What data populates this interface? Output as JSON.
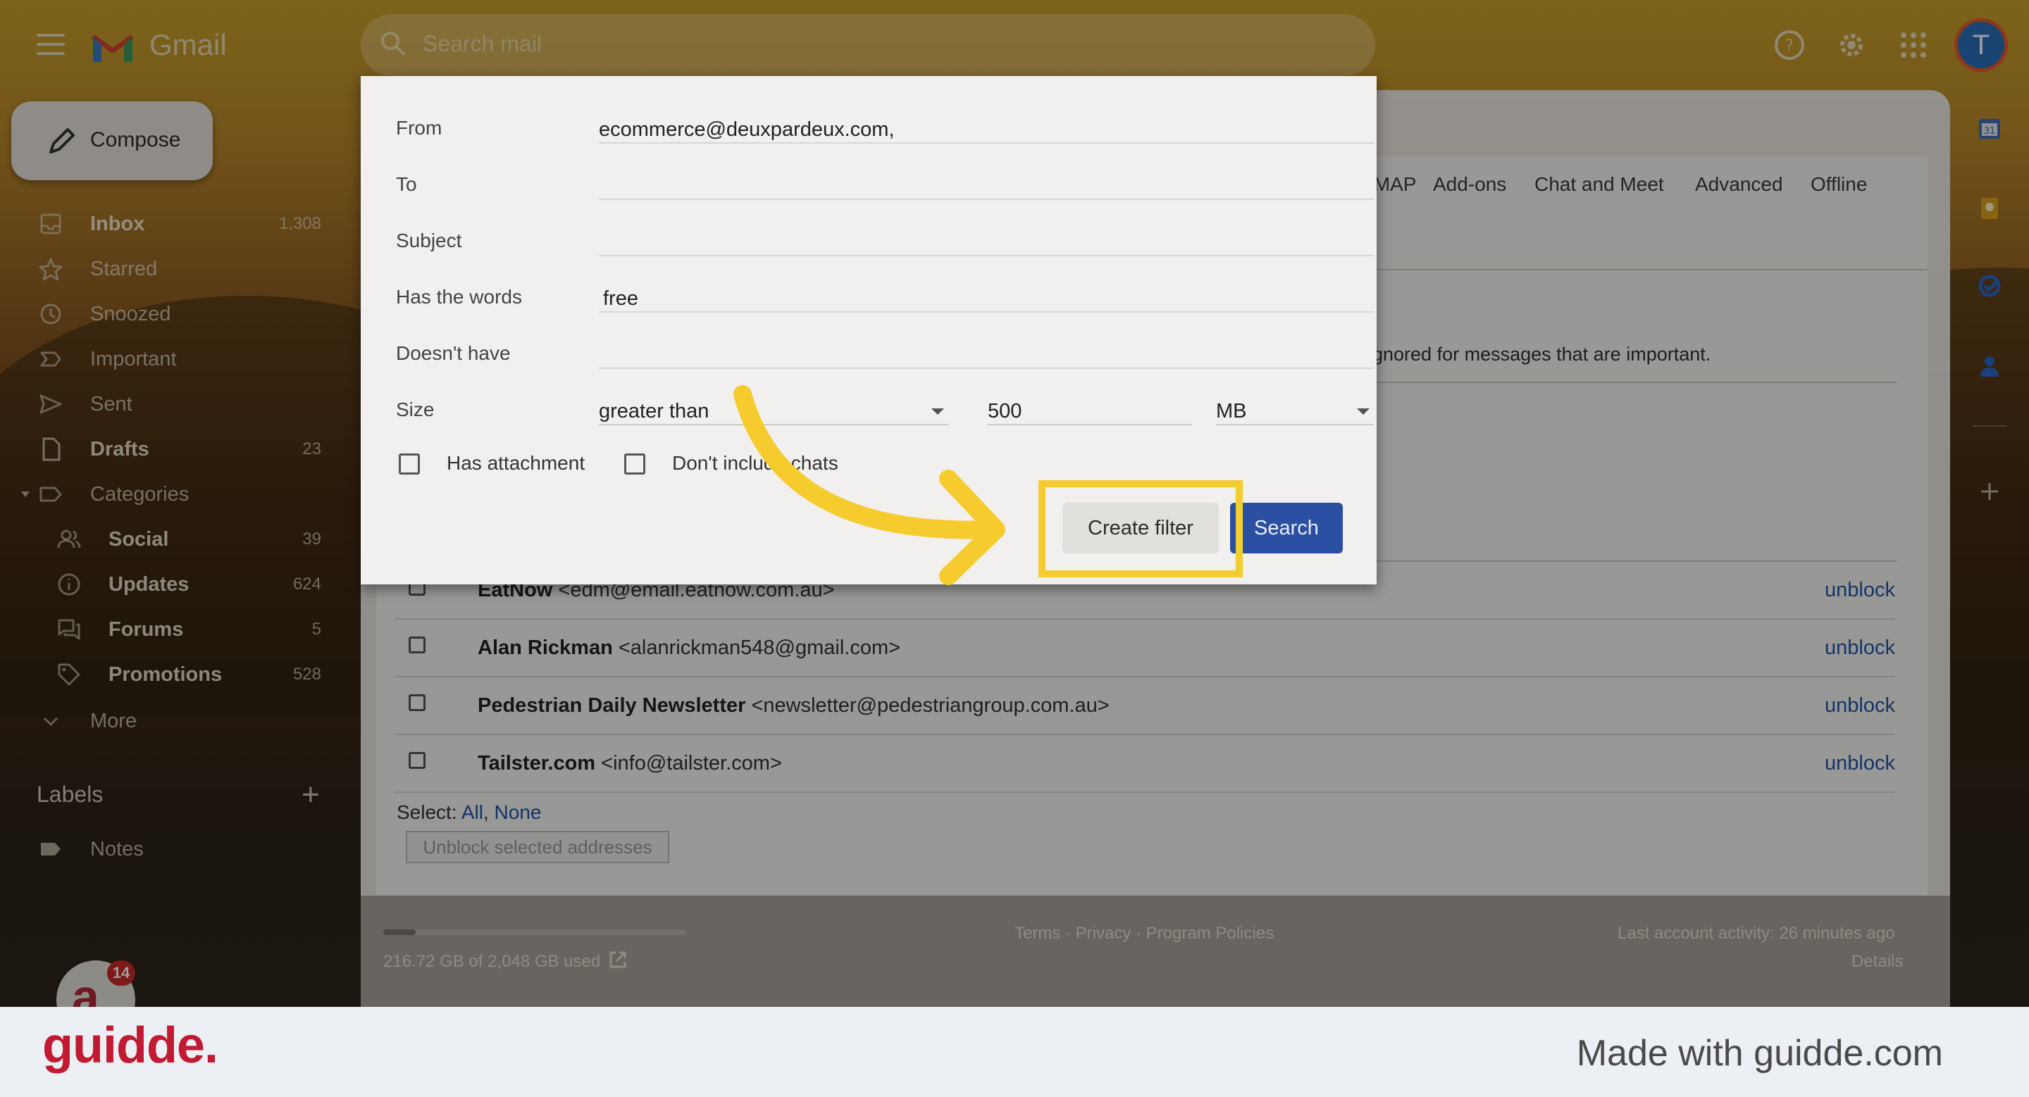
{
  "app": {
    "logo_text": "Gmail",
    "search_placeholder": "Search mail",
    "avatar_letter": "T"
  },
  "sidebar": {
    "compose_label": "Compose",
    "items": [
      {
        "label": "Inbox",
        "count": "1,308",
        "icon": "inbox-icon"
      },
      {
        "label": "Starred",
        "count": "",
        "icon": "star-icon"
      },
      {
        "label": "Snoozed",
        "count": "",
        "icon": "clock-icon"
      },
      {
        "label": "Important",
        "count": "",
        "icon": "important-icon"
      },
      {
        "label": "Sent",
        "count": "",
        "icon": "send-icon"
      },
      {
        "label": "Drafts",
        "count": "23",
        "icon": "draft-icon"
      },
      {
        "label": "Categories",
        "count": "",
        "icon": "label-icon"
      },
      {
        "label": "Social",
        "count": "39",
        "icon": "people-icon"
      },
      {
        "label": "Updates",
        "count": "624",
        "icon": "info-icon"
      },
      {
        "label": "Forums",
        "count": "5",
        "icon": "forum-icon"
      },
      {
        "label": "Promotions",
        "count": "528",
        "icon": "tag-icon"
      },
      {
        "label": "More",
        "count": "",
        "icon": "chevron-down-icon"
      }
    ],
    "labels_heading": "Labels",
    "labels_add": "+",
    "labels": [
      {
        "label": "Notes"
      }
    ],
    "badge_count": "14"
  },
  "settings": {
    "tabs": [
      "IMAP",
      "Add-ons",
      "Chat and Meet",
      "Advanced",
      "Offline"
    ],
    "notice": "ignored for messages that are important.",
    "blocked": [
      {
        "name": "EatNow",
        "email": "<edm@email.eatnow.com.au>",
        "action": "unblock"
      },
      {
        "name": "Alan Rickman",
        "email": "<alanrickman548@gmail.com>",
        "action": "unblock"
      },
      {
        "name": "Pedestrian Daily Newsletter",
        "email": "<newsletter@pedestriangroup.com.au>",
        "action": "unblock"
      },
      {
        "name": "Tailster.com",
        "email": "<info@tailster.com>",
        "action": "unblock"
      }
    ],
    "select_label": "Select:",
    "select_all": "All",
    "select_none": "None",
    "unblock_selected": "Unblock selected addresses"
  },
  "footer": {
    "storage": "216.72 GB of 2,048 GB used",
    "storage_fraction": 0.106,
    "links": "Terms · Privacy · Program Policies",
    "activity": "Last account activity: 26 minutes ago",
    "details": "Details"
  },
  "filter_dialog": {
    "from_label": "From",
    "from_value": "ecommerce@deuxpardeux.com,",
    "to_label": "To",
    "to_value": "",
    "subject_label": "Subject",
    "subject_value": "",
    "has_words_label": "Has the words",
    "has_words_value": "free",
    "doesnt_have_label": "Doesn't have",
    "doesnt_have_value": "",
    "size_label": "Size",
    "size_operator": "greater than",
    "size_value": "500",
    "size_unit": "MB",
    "has_attachment_label": "Has attachment",
    "dont_include_chats_label": "Don't include chats",
    "create_filter_label": "Create filter",
    "search_label": "Search"
  },
  "branding": {
    "logo": "guidde.",
    "made_with": "Made with guidde.com",
    "logo_color": "#c11a32",
    "highlight_color": "#f6cb2e"
  }
}
